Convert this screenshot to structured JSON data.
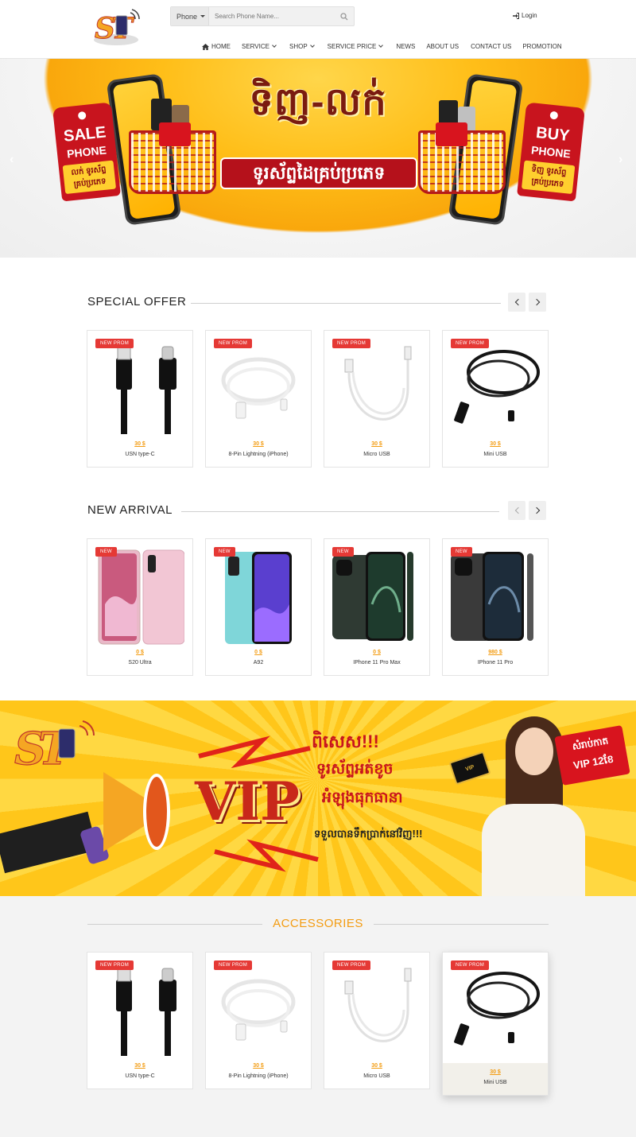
{
  "header": {
    "search": {
      "category": "Phone",
      "placeholder": "Search Phone Name..."
    },
    "login_label": "Login",
    "nav": [
      {
        "label": "HOME",
        "icon": "home-icon",
        "dropdown": false
      },
      {
        "label": "SERVICE",
        "dropdown": true
      },
      {
        "label": "SHOP",
        "dropdown": true
      },
      {
        "label": "SERVICE PRICE",
        "dropdown": true
      },
      {
        "label": "NEWS",
        "dropdown": false
      },
      {
        "label": "ABOUT US",
        "dropdown": false
      },
      {
        "label": "CONTACT US",
        "dropdown": false
      },
      {
        "label": "PROMOTION",
        "dropdown": false
      }
    ]
  },
  "hero": {
    "title_kh": "ទិញ-លក់",
    "subtitle_kh": "ទូរស័ព្ទដៃគ្រប់ប្រភេទ",
    "left_tag": {
      "line1": "SALE",
      "line2": "PHONE",
      "line3": "លក់ ទូរស័ព្ទ គ្រប់ប្រភេទ"
    },
    "right_tag": {
      "line1": "BUY",
      "line2": "PHONE",
      "line3": "ទិញ ទូរស័ព្ទ គ្រប់ប្រភេទ"
    }
  },
  "special_offer": {
    "title": "SPECIAL OFFER",
    "products": [
      {
        "badge": "NEW PROM",
        "price": "30 $",
        "name": "USN type-C",
        "image": "usb-c-cable"
      },
      {
        "badge": "NEW PROM",
        "price": "30 $",
        "name": "8-Pin Lightning (iPhone)",
        "image": "lightning-cable"
      },
      {
        "badge": "NEW PROM",
        "price": "30 $",
        "name": "Micro USB",
        "image": "micro-usb-cable"
      },
      {
        "badge": "NEW PROM",
        "price": "30 $",
        "name": "Mini USB",
        "image": "mini-usb-cable"
      }
    ]
  },
  "new_arrival": {
    "title": "NEW ARRIVAL",
    "products": [
      {
        "badge": "NEW",
        "price": "0 $",
        "name": "S20 Ultra",
        "image": "pink-phone"
      },
      {
        "badge": "NEW",
        "price": "0 $",
        "name": "A92",
        "image": "purple-phone"
      },
      {
        "badge": "NEW",
        "price": "0 $",
        "name": "IPhone 11 Pro Max",
        "image": "green-iphone"
      },
      {
        "badge": "NEW",
        "price": "980 $",
        "name": "IPhone 11 Pro",
        "image": "grey-iphone"
      }
    ]
  },
  "vip_banner": {
    "vip": "VIP",
    "line1": "ពិសេស!!!",
    "line2": "ទូរស័ព្ទអត់ខូច",
    "line3": "អំឡុងធុកធានា",
    "line4": "ទទួលបានទឹកប្រាក់នៅវិញ!!!",
    "tag_line1": "សំរាប់កាត",
    "tag_line2": "VIP 12ខែ",
    "card_label": "VIP"
  },
  "accessories": {
    "title": "ACCESSORIES",
    "products": [
      {
        "badge": "NEW PROM",
        "price": "30 $",
        "name": "USN type-C",
        "image": "usb-c-cable"
      },
      {
        "badge": "NEW PROM",
        "price": "30 $",
        "name": "8-Pin Lightning (iPhone)",
        "image": "lightning-cable"
      },
      {
        "badge": "NEW PROM",
        "price": "30 $",
        "name": "Micro USB",
        "image": "micro-usb-cable"
      },
      {
        "badge": "NEW PROM",
        "price": "30 $",
        "name": "Mini USB",
        "image": "mini-usb-cable"
      }
    ]
  },
  "colors": {
    "accent": "#f39c12",
    "badge": "#e53935",
    "brand_red": "#c8141e",
    "banner_yellow": "#ffc61a"
  }
}
